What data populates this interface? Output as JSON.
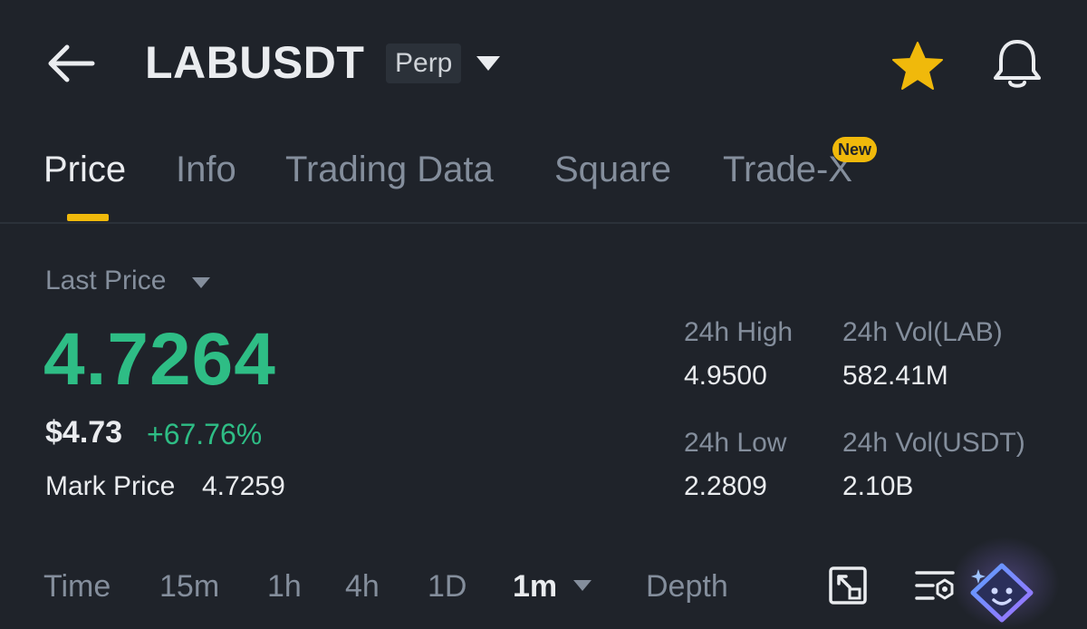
{
  "header": {
    "symbol": "LABUSDT",
    "contract_type": "Perp",
    "icons": [
      "back-arrow-icon",
      "chevron-down-icon",
      "star-icon",
      "bell-icon"
    ]
  },
  "tabs": [
    {
      "label": "Price",
      "active": true
    },
    {
      "label": "Info"
    },
    {
      "label": "Trading Data"
    },
    {
      "label": "Square"
    },
    {
      "label": "Trade-X",
      "badge": "New"
    }
  ],
  "price": {
    "last_price_label": "Last Price",
    "last_price": "4.7264",
    "usd_price": "$4.73",
    "change_pct": "+67.76%",
    "mark_price_label": "Mark Price",
    "mark_price": "4.7259"
  },
  "stats": {
    "high_label": "24h High",
    "high_value": "4.9500",
    "low_label": "24h Low",
    "low_value": "2.2809",
    "vol_base_label": "24h Vol(LAB)",
    "vol_base_value": "582.41M",
    "vol_quote_label": "24h Vol(USDT)",
    "vol_quote_value": "2.10B"
  },
  "timeframes": {
    "items": [
      "Time",
      "15m",
      "1h",
      "4h",
      "1D"
    ],
    "selected": "1m",
    "depth": "Depth"
  },
  "colors": {
    "background": "#1f232a",
    "accent": "#f0b90b",
    "positive": "#2ebd85",
    "muted": "#848e9c",
    "text": "#eaecef"
  }
}
